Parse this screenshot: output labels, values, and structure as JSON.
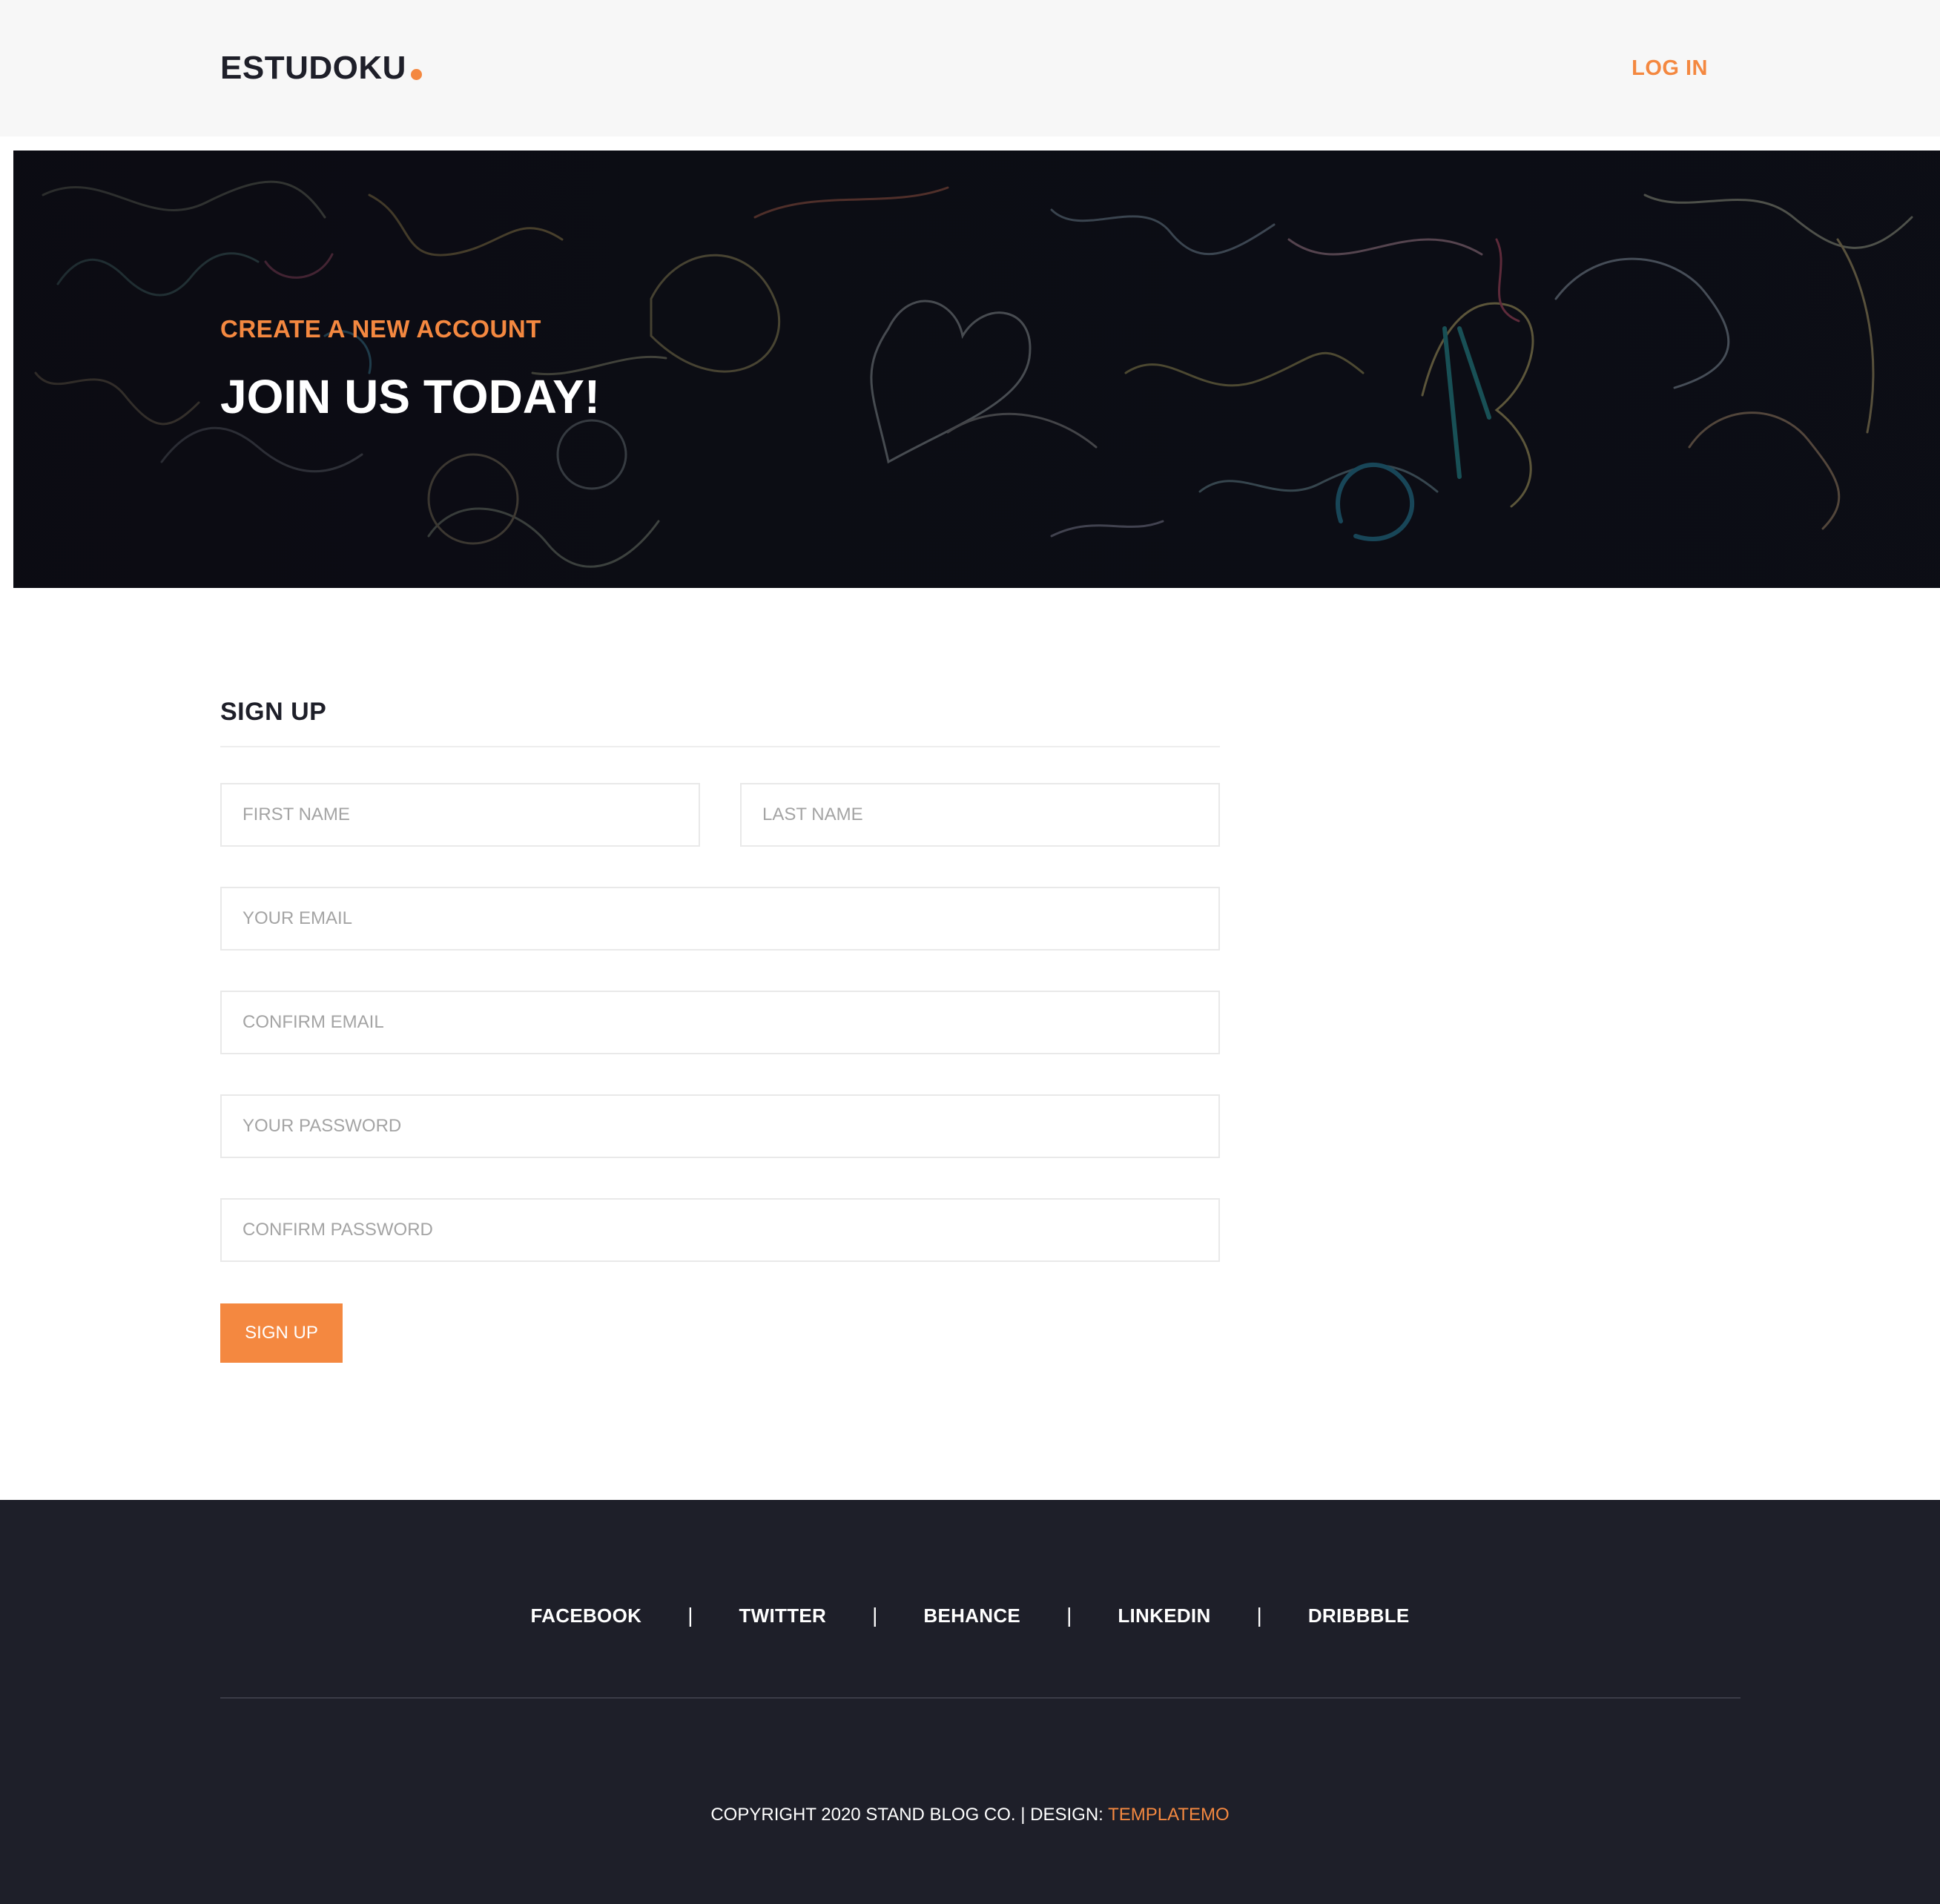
{
  "header": {
    "logo_text": "ESTUDOKU",
    "login_label": "LOG IN"
  },
  "hero": {
    "subtitle": "CREATE A NEW ACCOUNT",
    "title": "JOIN US TODAY!"
  },
  "form": {
    "heading": "SIGN UP",
    "fields": {
      "first_name": {
        "placeholder": "First name",
        "value": ""
      },
      "last_name": {
        "placeholder": "Last name",
        "value": ""
      },
      "email": {
        "placeholder": "Your email",
        "value": ""
      },
      "confirm_email": {
        "placeholder": "Confirm email",
        "value": ""
      },
      "password": {
        "placeholder": "Your password",
        "value": ""
      },
      "confirm_password": {
        "placeholder": "Confirm password",
        "value": ""
      }
    },
    "submit_label": "SIGN UP"
  },
  "footer": {
    "social": [
      {
        "label": "FACEBOOK"
      },
      {
        "label": "TWITTER"
      },
      {
        "label": "BEHANCE"
      },
      {
        "label": "LINKEDIN"
      },
      {
        "label": "DRIBBBLE"
      }
    ],
    "separator": "|",
    "copyright_text": "COPYRIGHT 2020 STAND BLOG CO. | DESIGN: ",
    "copyright_link": "TEMPLATEMO"
  },
  "colors": {
    "accent": "#f48840",
    "dark": "#1e1f29",
    "header_bg": "#f7f7f7",
    "field_border": "#e9e9e9",
    "placeholder": "#a4a4a4"
  }
}
